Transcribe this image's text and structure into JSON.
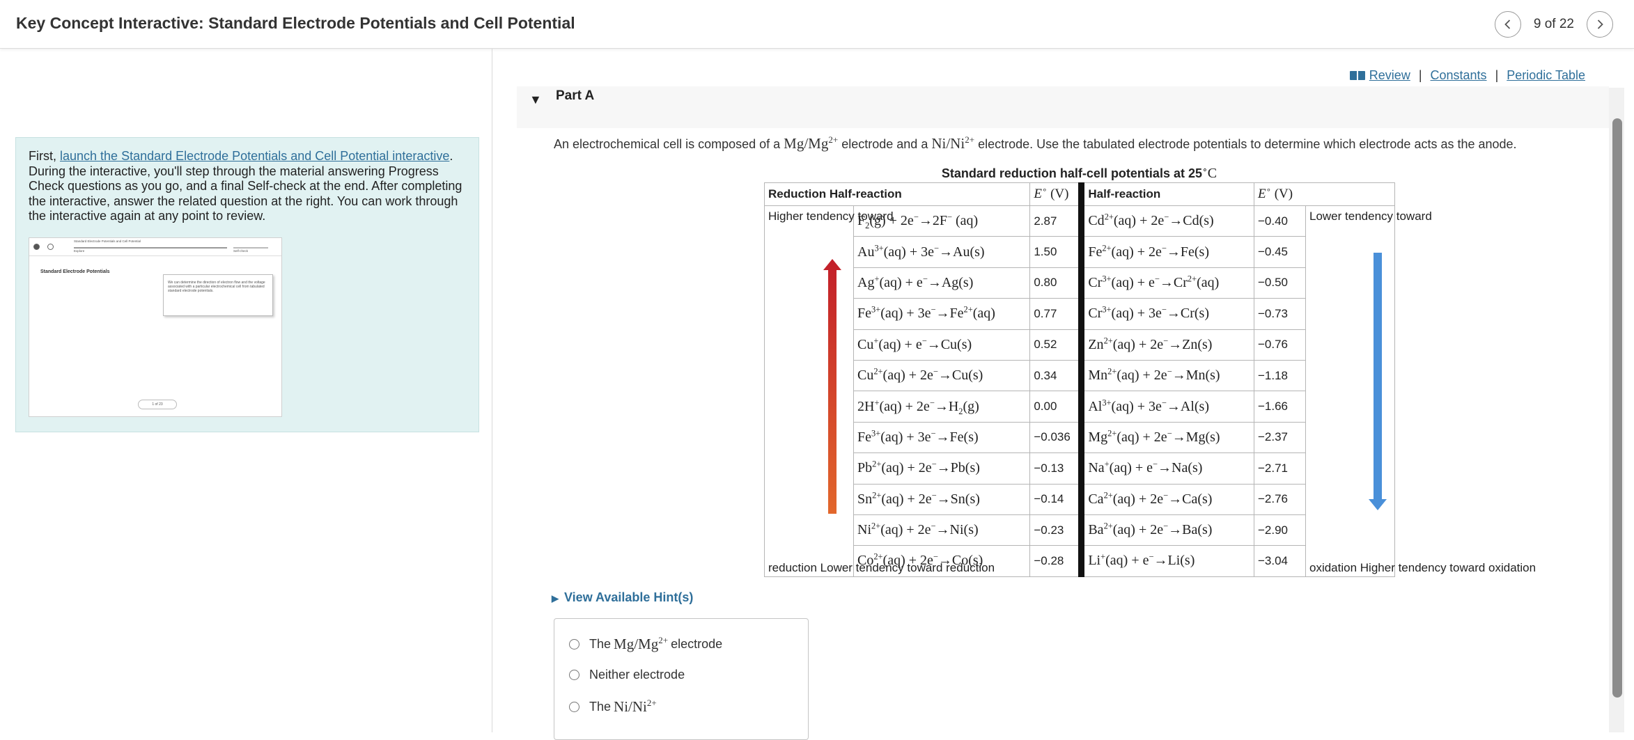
{
  "header": {
    "title": "Key Concept Interactive: Standard Electrode Potentials and Cell Potential",
    "page_indicator": "9 of 22"
  },
  "left": {
    "intro_prefix": "First, ",
    "intro_link": "launch the Standard Electrode Potentials and Cell Potential interactive",
    "intro_rest": ". During the interactive, you'll step through the material answering Progress Check questions as you go, and a final Self-check at the end. After completing the interactive, answer the related question at the right. You can work through the interactive again at any point to review.",
    "thumb": {
      "bar_title": "Standard Electrode Potentials and Cell Potential",
      "bar_left": "Explore",
      "bar_right": "Self-check",
      "title": "Standard Electrode Potentials",
      "card_text": "We can determine the direction of electron flow and the voltage associated with a particular electrochemical cell from tabulated standard electrode potentials.",
      "pager": "1 of 23"
    }
  },
  "links": {
    "review": "Review",
    "constants": "Constants",
    "periodic": "Periodic Table"
  },
  "part": {
    "label": "Part A"
  },
  "question": {
    "t1": "An electrochemical cell is composed of a",
    "t2": "electrode and a",
    "t3": "electrode. Use the tabulated electrode potentials to determine which electrode acts as the anode."
  },
  "table": {
    "caption": "Standard reduction half-cell potentials at 25",
    "head_reaction": "Reduction Half-reaction",
    "head_reaction2": "Half-reaction",
    "left_side": {
      "top": "Higher tendency toward",
      "bottom": "reduction Lower tendency toward reduction"
    },
    "right_side": {
      "top": "Lower tendency toward",
      "bottom": "oxidation Higher tendency toward oxidation"
    },
    "left_values": [
      "2.87",
      "1.50",
      "0.80",
      "0.77",
      "0.52",
      "0.34",
      "0.00",
      "−0.036",
      "−0.13",
      "−0.14",
      "−0.23",
      "−0.28"
    ],
    "right_values": [
      "−0.40",
      "−0.45",
      "−0.50",
      "−0.73",
      "−0.76",
      "−1.18",
      "−1.66",
      "−2.37",
      "−2.71",
      "−2.76",
      "−2.90",
      "−3.04"
    ]
  },
  "hints": {
    "label": "View Available Hint(s)"
  },
  "answers": {
    "opt1_a": "The",
    "opt1_b": "electrode",
    "opt2": "Neither electrode",
    "opt3_a": "The"
  },
  "colors": {
    "accent_link": "#2f6f9a",
    "panel_bg": "#e1f2f2",
    "red_arrow": "#c4312c",
    "blue_arrow": "#4a90d9"
  }
}
